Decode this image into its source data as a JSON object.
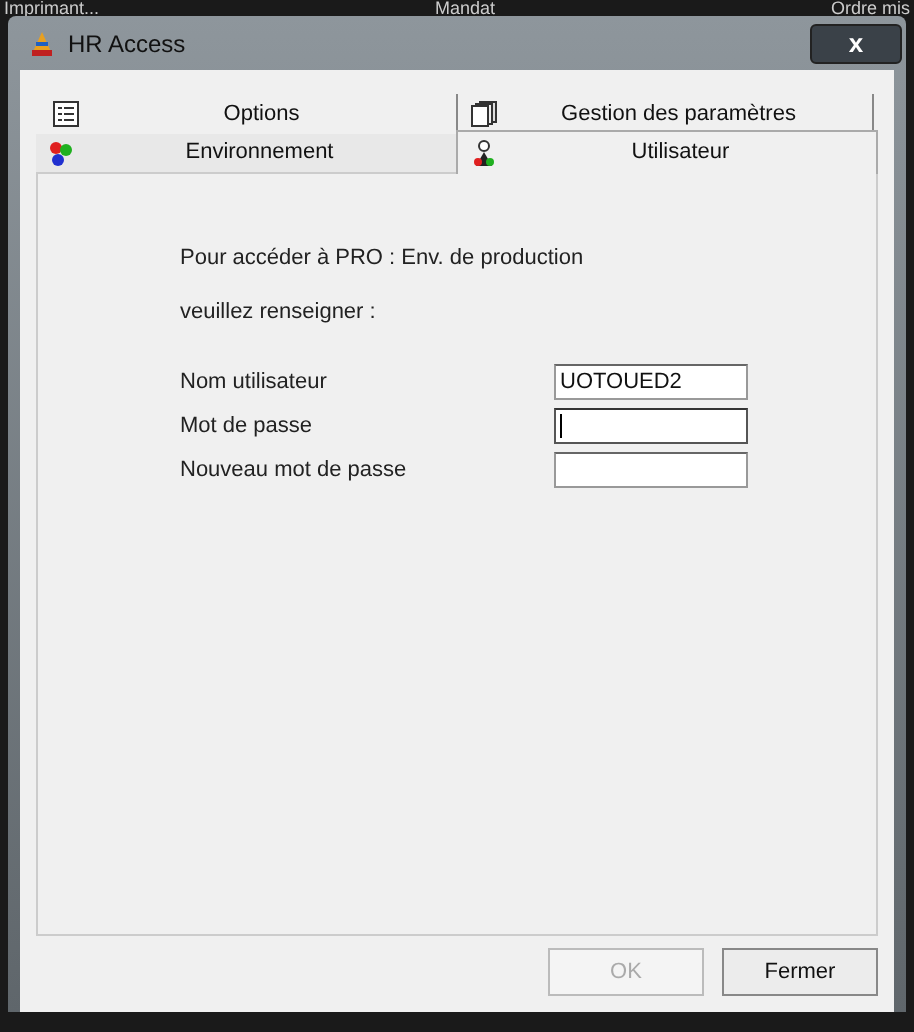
{
  "background_labels": [
    "Imprimant...",
    "Mandat",
    "Ordre mis"
  ],
  "window": {
    "title": "HR Access",
    "close": "x"
  },
  "tab_rows": [
    [
      {
        "label": "Options",
        "selected": false
      },
      {
        "label": "Gestion des paramètres",
        "selected": false
      }
    ],
    [
      {
        "label": "Environnement",
        "selected": false
      },
      {
        "label": "Utilisateur",
        "selected": true
      }
    ]
  ],
  "intro": [
    "Pour accéder à  PRO : Env. de production",
    "veuillez renseigner :"
  ],
  "fields": [
    {
      "label": "Nom utilisateur",
      "value": "UOTOUED2",
      "focused": false
    },
    {
      "label": "Mot de passe",
      "focused": true
    },
    {
      "label": "Nouveau mot de passe",
      "focused": false
    }
  ],
  "buttons": [
    {
      "label": "OK",
      "disabled": true
    },
    {
      "label": "Fermer",
      "disabled": false
    }
  ]
}
